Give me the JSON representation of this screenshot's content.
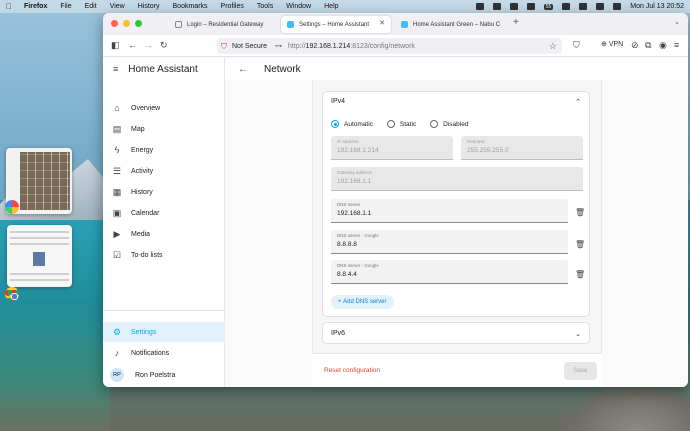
{
  "menubar": {
    "app": "Firefox",
    "items": [
      "File",
      "Edit",
      "View",
      "History",
      "Bookmarks",
      "Profiles",
      "Tools",
      "Window",
      "Help"
    ],
    "clock": "Mon Jul 13  20:52",
    "badge": "55"
  },
  "browser": {
    "tabs": [
      {
        "title": "Login – Residential Gateway"
      },
      {
        "title": "Settings – Home Assistant"
      },
      {
        "title": "Home Assistant Green – Nabu C"
      }
    ],
    "security_label": "Not Secure",
    "url_prefix": "http://",
    "url_host": "192.168.1.214",
    "url_rest": ":8123/config/network",
    "vpn_label": "VPN"
  },
  "sidebar": {
    "title": "Home Assistant",
    "items": [
      {
        "label": "Overview",
        "icon": "overview-icon"
      },
      {
        "label": "Map",
        "icon": "map-icon"
      },
      {
        "label": "Energy",
        "icon": "energy-icon"
      },
      {
        "label": "Activity",
        "icon": "activity-icon"
      },
      {
        "label": "History",
        "icon": "history-icon"
      },
      {
        "label": "Calendar",
        "icon": "calendar-icon"
      },
      {
        "label": "Media",
        "icon": "media-icon"
      },
      {
        "label": "To-do lists",
        "icon": "todo-icon"
      }
    ],
    "settings_label": "Settings",
    "notifications_label": "Notifications",
    "user": {
      "initials": "RP",
      "name": "Ron Poelstra"
    }
  },
  "main": {
    "title": "Network",
    "ipv4": {
      "heading": "IPv4",
      "modes": [
        "Automatic",
        "Static",
        "Disabled"
      ],
      "selected_mode": "Automatic",
      "ip_address": {
        "label": "IP address",
        "value": "192.168.1.214"
      },
      "netmask": {
        "label": "Netmask",
        "value": "255.255.255.0"
      },
      "gateway": {
        "label": "Gateway address",
        "value": "192.168.1.1"
      },
      "dns_servers": [
        {
          "label": "DNS server",
          "value": "192.168.1.1"
        },
        {
          "label": "DNS server - Google",
          "value": "8.8.8.8"
        },
        {
          "label": "DNS server - Google",
          "value": "8.8.4.4"
        }
      ],
      "add_dns_label": "Add DNS server"
    },
    "ipv6": {
      "heading": "IPv6"
    },
    "reset_label": "Reset configuration",
    "save_label": "Save"
  },
  "colors": {
    "accent": "#03a9f4",
    "danger": "#db4437",
    "active_bg": "#e3f1fb"
  }
}
